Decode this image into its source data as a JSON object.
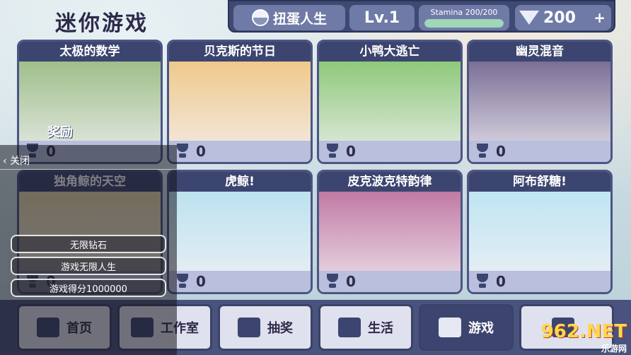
{
  "title": "迷你游戏",
  "topbar": {
    "gacha_label": "扭蛋人生",
    "level_label": "Lv.1",
    "stamina_label": "Stamina 200/200",
    "stamina_fraction": 1.0,
    "gems_value": "200",
    "plus": "+"
  },
  "games": [
    {
      "name": "太极的数学",
      "score": "0",
      "art_color": "#9fbf8a",
      "sub": "奖励"
    },
    {
      "name": "贝克斯的节日",
      "score": "0",
      "art_color": "#f0c98a"
    },
    {
      "name": "小鸭大逃亡",
      "score": "0",
      "art_color": "#8fc97a"
    },
    {
      "name": "幽灵混音",
      "score": "0",
      "art_color": "#7b6f96"
    },
    {
      "name": "独角鲸的天空",
      "score": "0",
      "art_color": "#e8d7a8"
    },
    {
      "name": "虎鲸!",
      "score": "0",
      "art_color": "#bde2ef"
    },
    {
      "name": "皮克波克特韵律",
      "score": "0",
      "art_color": "#c17aa3"
    },
    {
      "name": "阿布舒糖!",
      "score": "0",
      "art_color": "#bfe5f2"
    }
  ],
  "nav": [
    {
      "label": "首页",
      "icon": "home-icon"
    },
    {
      "label": "工作室",
      "icon": "camera-icon"
    },
    {
      "label": "抽奖",
      "icon": "gacha-icon"
    },
    {
      "label": "生活",
      "icon": "tree-icon"
    },
    {
      "label": "游戏",
      "icon": "gamepad-icon",
      "active": true
    },
    {
      "label": "",
      "icon": "gear-icon"
    }
  ],
  "panel": {
    "close_label": "关闭",
    "options": [
      "无限钻石",
      "游戏无限人生",
      "游戏得分1000000"
    ]
  },
  "watermark": {
    "big": "962.NET",
    "small": "乐游网"
  }
}
